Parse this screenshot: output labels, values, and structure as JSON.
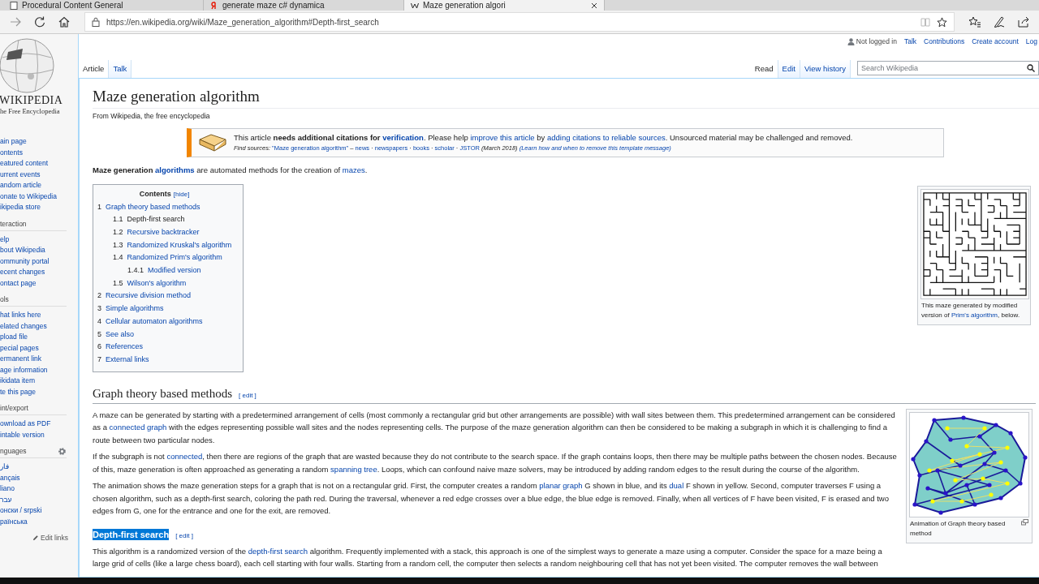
{
  "browser": {
    "tabs": [
      {
        "title": "Procedural Content General",
        "kind": "page",
        "selected": false
      },
      {
        "title": "generate maze c# dynamica",
        "kind": "yandex",
        "selected": false
      },
      {
        "title": "Maze generation algori",
        "kind": "wikipedia",
        "selected": true
      }
    ],
    "url": "https://en.wikipedia.org/wiki/Maze_generation_algorithm#Depth-first_search"
  },
  "logo": {
    "wordmark": "WIKIPEDIA",
    "tagline": "he Free Encyclopedia"
  },
  "sidebar": {
    "sections": [
      {
        "settings_icon": false,
        "items": [
          "ain page",
          "ontents",
          "eatured content",
          "urrent events",
          "andom article",
          "onate to Wikipedia",
          "ikipedia store"
        ]
      },
      {
        "heading": "teraction",
        "settings_icon": false,
        "items": [
          "elp",
          "bout Wikipedia",
          "ommunity portal",
          "ecent changes",
          "ontact page"
        ]
      },
      {
        "heading": "ols",
        "settings_icon": false,
        "items": [
          "hat links here",
          "elated changes",
          "pload file",
          "pecial pages",
          "ermanent link",
          "age information",
          "ikidata item",
          "te this page"
        ]
      },
      {
        "heading": "int/export",
        "settings_icon": false,
        "items": [
          "ownload as PDF",
          "intable version"
        ]
      },
      {
        "heading": "nguages",
        "settings_icon": true,
        "items": [
          "فار",
          "ançais",
          "liano",
          "עבר",
          "онски / srpski",
          "раїнська"
        ]
      }
    ],
    "edit_links": "Edit links"
  },
  "personal_tools": [
    {
      "label": "Not logged in",
      "kind": "status"
    },
    {
      "label": "Talk",
      "kind": "link"
    },
    {
      "label": "Contributions",
      "kind": "link"
    },
    {
      "label": "Create account",
      "kind": "link"
    },
    {
      "label": "Log",
      "kind": "link"
    }
  ],
  "namespace_tabs": [
    {
      "label": "Article",
      "selected": true
    },
    {
      "label": "Talk",
      "selected": false
    }
  ],
  "view_tabs": [
    {
      "label": "Read",
      "selected": true
    },
    {
      "label": "Edit",
      "selected": false
    },
    {
      "label": "View history",
      "selected": false
    }
  ],
  "search": {
    "placeholder": "Search Wikipedia"
  },
  "article": {
    "title": "Maze generation algorithm",
    "subtitle": "From Wikipedia, the free encyclopedia",
    "notice": {
      "line_1": [
        {
          "kind": "plain",
          "text": "This article "
        },
        {
          "kind": "bold",
          "text": "needs additional citations for "
        },
        {
          "kind": "bold-link",
          "text": "verification"
        },
        {
          "kind": "plain",
          "text": ". Please help "
        },
        {
          "kind": "link",
          "text": "improve this article"
        },
        {
          "kind": "plain",
          "text": " by "
        },
        {
          "kind": "link",
          "text": "adding citations to reliable sources"
        },
        {
          "kind": "plain",
          "text": ". Unsourced material may be challenged and removed."
        }
      ],
      "line_2": [
        {
          "kind": "italic",
          "text": "Find sources: "
        },
        {
          "kind": "link",
          "text": "\"Maze generation algorithm\""
        },
        {
          "kind": "plain",
          "text": " – "
        },
        {
          "kind": "link",
          "text": "news"
        },
        {
          "kind": "plain",
          "text": " · "
        },
        {
          "kind": "link",
          "text": "newspapers"
        },
        {
          "kind": "plain",
          "text": " · "
        },
        {
          "kind": "link",
          "text": "books"
        },
        {
          "kind": "plain",
          "text": " · "
        },
        {
          "kind": "link",
          "text": "scholar"
        },
        {
          "kind": "plain",
          "text": " · "
        },
        {
          "kind": "link",
          "text": "JSTOR"
        },
        {
          "kind": "italic",
          "text": " (March 2018) "
        },
        {
          "kind": "italic-link",
          "text": "(Learn how and when to remove this template message)"
        }
      ]
    },
    "intro": [
      {
        "kind": "bold",
        "text": "Maze generation "
      },
      {
        "kind": "bold-link",
        "text": "algorithms"
      },
      {
        "kind": "plain",
        "text": " are automated methods for the creation of "
      },
      {
        "kind": "link",
        "text": "mazes"
      },
      {
        "kind": "plain",
        "text": "."
      }
    ],
    "contents": {
      "title": "Contents",
      "hide_label": "[hide]",
      "items": [
        {
          "number": "1",
          "label": "Graph theory based methods",
          "visited": false,
          "children": [
            {
              "number": "1.1",
              "label": "Depth-first search",
              "visited": true
            },
            {
              "number": "1.2",
              "label": "Recursive backtracker",
              "visited": false
            },
            {
              "number": "1.3",
              "label": "Randomized Kruskal's algorithm",
              "visited": false
            },
            {
              "number": "1.4",
              "label": "Randomized Prim's algorithm",
              "visited": false,
              "children": [
                {
                  "number": "1.4.1",
                  "label": "Modified version",
                  "visited": false
                }
              ]
            },
            {
              "number": "1.5",
              "label": "Wilson's algorithm",
              "visited": false
            }
          ]
        },
        {
          "number": "2",
          "label": "Recursive division method",
          "visited": false
        },
        {
          "number": "3",
          "label": "Simple algorithms",
          "visited": false
        },
        {
          "number": "4",
          "label": "Cellular automaton algorithms",
          "visited": false
        },
        {
          "number": "5",
          "label": "See also",
          "visited": false
        },
        {
          "number": "6",
          "label": "References",
          "visited": false
        },
        {
          "number": "7",
          "label": "External links",
          "visited": false
        }
      ]
    },
    "maze_figure": {
      "caption": [
        {
          "kind": "plain",
          "text": "This maze generated by modified version of "
        },
        {
          "kind": "link",
          "text": "Prim's algorithm"
        },
        {
          "kind": "plain",
          "text": ", below."
        }
      ]
    },
    "graph_figure": {
      "caption": "Animation of Graph theory based method"
    },
    "sections": [
      {
        "kind": "h2",
        "heading": "Graph theory based methods",
        "highlighted": false,
        "edit_label": "[ edit ]",
        "paragraphs": [
          [
            {
              "kind": "plain",
              "text": "A maze can be generated by starting with a predetermined arrangement of cells (most commonly a rectangular grid but other arrangements are possible) with wall sites between them. This predetermined arrangement can be considered as a "
            },
            {
              "kind": "link",
              "text": "connected graph"
            },
            {
              "kind": "plain",
              "text": " with the edges representing possible wall sites and the nodes representing cells. The purpose of the maze generation algorithm can then be considered to be making a subgraph in which it is challenging to find a route between two particular nodes."
            }
          ],
          [
            {
              "kind": "plain",
              "text": "If the subgraph is not "
            },
            {
              "kind": "link",
              "text": "connected"
            },
            {
              "kind": "plain",
              "text": ", then there are regions of the graph that are wasted because they do not contribute to the search space. If the graph contains loops, then there may be multiple paths between the chosen nodes. Because of this, maze generation is often approached as generating a random "
            },
            {
              "kind": "link",
              "text": "spanning tree"
            },
            {
              "kind": "plain",
              "text": ". Loops, which can confound naive maze solvers, may be introduced by adding random edges to the result during the course of the algorithm."
            }
          ],
          [
            {
              "kind": "plain",
              "text": "The animation shows the maze generation steps for a graph that is not on a rectangular grid. First, the computer creates a random "
            },
            {
              "kind": "link",
              "text": "planar graph"
            },
            {
              "kind": "plain",
              "text": " G shown in blue, and its "
            },
            {
              "kind": "link",
              "text": "dual"
            },
            {
              "kind": "plain",
              "text": " F shown in yellow. Second, computer traverses F using a chosen algorithm, such as a depth-first search, coloring the path red. During the traversal, whenever a red edge crosses over a blue edge, the blue edge is removed. Finally, when all vertices of F have been visited, F is erased and two edges from G, one for the entrance and one for the exit, are removed."
            }
          ]
        ]
      },
      {
        "kind": "h3",
        "heading": "Depth-first search",
        "highlighted": true,
        "edit_label": "[ edit ]",
        "paragraphs": [
          [
            {
              "kind": "plain",
              "text": "This algorithm is a randomized version of the "
            },
            {
              "kind": "link",
              "text": "depth-first search"
            },
            {
              "kind": "plain",
              "text": " algorithm. Frequently implemented with a stack, this approach is one of the simplest ways to generate a maze using a computer. Consider the space for a maze being a large grid of cells (like a large chess board), each cell starting with four walls. Starting from a random cell, the computer then selects a random neighbouring cell that has not yet been visited. The computer removes the wall between"
            }
          ]
        ]
      }
    ]
  }
}
